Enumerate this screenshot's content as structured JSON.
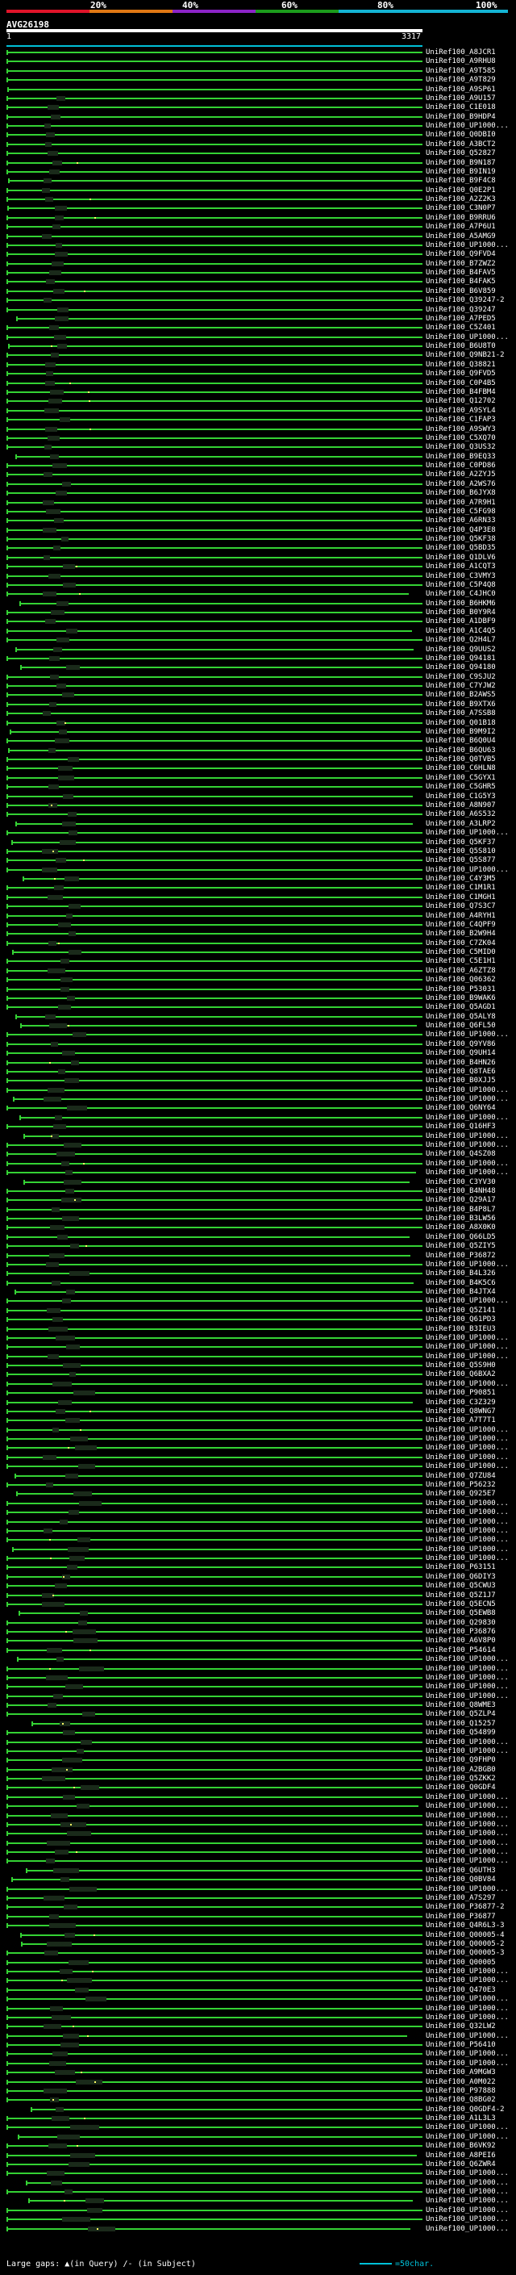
{
  "scale": {
    "labels": [
      "20%",
      "40%",
      "60%",
      "80%",
      "100%"
    ],
    "colors": [
      "#e0142a",
      "#e07814",
      "#8c24c8",
      "#1c9c1c",
      "#14b4d4"
    ]
  },
  "query": {
    "name": "AVG26198",
    "start": "1",
    "end": "3317",
    "line_color": "#00c0d8"
  },
  "hits": [
    "UniRef100_A8JCR1",
    "UniRef100_A9RHU8",
    "UniRef100_A9T585",
    "UniRef100_A9T829",
    "UniRef100_A9SP61",
    "UniRef100_A9U157",
    "UniRef100_C1E018",
    "UniRef100_B9HDP4",
    "UniRef100_UP1000...",
    "UniRef100_Q0DBI0",
    "UniRef100_A3BCT2",
    "UniRef100_Q52827",
    "UniRef100_B9N187",
    "UniRef100_B9IN19",
    "UniRef100_B9F4C8",
    "UniRef100_Q0E2P1",
    "UniRef100_A2Z2K3",
    "UniRef100_C3N0P7",
    "UniRef100_B9RRU6",
    "UniRef100_A7P6U1",
    "UniRef100_A5AMG9",
    "UniRef100_UP1000...",
    "UniRef100_Q9FVD4",
    "UniRef100_B7ZWZ2",
    "UniRef100_B4FAV5",
    "UniRef100_B4FAK5",
    "UniRef100_B6V859",
    "UniRef100_Q39247-2",
    "UniRef100_Q39247",
    "UniRef100_A7PED5",
    "UniRef100_C5Z401",
    "UniRef100_UP1000...",
    "UniRef100_B6U8T0",
    "UniRef100_Q9NB21-2",
    "UniRef100_Q38821",
    "UniRef100_Q9FVD5",
    "UniRef100_C0P4B5",
    "UniRef100_B4FBM4",
    "UniRef100_Q12702",
    "UniRef100_A9SYL4",
    "UniRef100_C1FAP3",
    "UniRef100_A9SWY3",
    "UniRef100_C5XQ70",
    "UniRef100_Q3US32",
    "UniRef100_B9EQ33",
    "UniRef100_C0PD86",
    "UniRef100_A2ZYJ5",
    "UniRef100_A2WS76",
    "UniRef100_B6JYX8",
    "UniRef100_A7R9H1",
    "UniRef100_C5FG98",
    "UniRef100_A6RN33",
    "UniRef100_Q4P3E8",
    "UniRef100_Q5KF38",
    "UniRef100_Q5BD35",
    "UniRef100_Q1DLV6",
    "UniRef100_A1CQT3",
    "UniRef100_C3VMY3",
    "UniRef100_C5P4Q8",
    "UniRef100_C4JHC0",
    "UniRef100_B6HKM6",
    "UniRef100_B0Y9R4",
    "UniRef100_A1DBF9",
    "UniRef100_A1C4Q5",
    "UniRef100_Q2H4L7",
    "UniRef100_Q9UUS2",
    "UniRef100_Q94181",
    "UniRef100_Q94180",
    "UniRef100_C9SJU2",
    "UniRef100_C7YJW2",
    "UniRef100_B2AWS5",
    "UniRef100_B9XTX6",
    "UniRef100_A7SSB8",
    "UniRef100_Q01B18",
    "UniRef100_B9M9I2",
    "UniRef100_B6Q0U4",
    "UniRef100_B6QU63",
    "UniRef100_Q0TVB5",
    "UniRef100_C6HLN8",
    "UniRef100_C5GYX1",
    "UniRef100_C5GHR5",
    "UniRef100_C1G5Y3",
    "UniRef100_A8N907",
    "UniRef100_A6S532",
    "UniRef100_A3LRP2",
    "UniRef100_UP1000...",
    "UniRef100_Q5KF37",
    "UniRef100_Q5S810",
    "UniRef100_Q5S877",
    "UniRef100_UP1000...",
    "UniRef100_C4Y3M5",
    "UniRef100_C1M1R1",
    "UniRef100_C1MGH1",
    "UniRef100_Q7S3C7",
    "UniRef100_A4RYH1",
    "UniRef100_C4QPF9",
    "UniRef100_B2W9H4",
    "UniRef100_C7ZK04",
    "UniRef100_C5MID0",
    "UniRef100_C5E1H1",
    "UniRef100_A6ZTZ8",
    "UniRef100_Q06362",
    "UniRef100_P53031",
    "UniRef100_B9WAK6",
    "UniRef100_Q5AGD1",
    "UniRef100_Q5ALY8",
    "UniRef100_Q6FL50",
    "UniRef100_UP1000...",
    "UniRef100_Q9YV86",
    "UniRef100_Q9UH14",
    "UniRef100_B4HN26",
    "UniRef100_Q8TAE6",
    "UniRef100_B0XJJ5",
    "UniRef100_UP1000...",
    "UniRef100_UP1000...",
    "UniRef100_Q6NY64",
    "UniRef100_UP1000...",
    "UniRef100_Q16HF3",
    "UniRef100_UP1000...",
    "UniRef100_UP1000...",
    "UniRef100_Q4SZ08",
    "UniRef100_UP1000...",
    "UniRef100_UP1000...",
    "UniRef100_C3YV30",
    "UniRef100_B4NH48",
    "UniRef100_Q29A17",
    "UniRef100_B4P8L7",
    "UniRef100_B3LW56",
    "UniRef100_A8X0K0",
    "UniRef100_Q66LD5",
    "UniRef100_Q5ZIY5",
    "UniRef100_P36872",
    "UniRef100_UP1000...",
    "UniRef100_B4L326",
    "UniRef100_B4K5C6",
    "UniRef100_B4JTX4",
    "UniRef100_UP1000...",
    "UniRef100_Q5Z141",
    "UniRef100_Q61PD3",
    "UniRef100_B3IEU3",
    "UniRef100_UP1000...",
    "UniRef100_UP1000...",
    "UniRef100_UP1000...",
    "UniRef100_Q5S9H0",
    "UniRef100_Q6BXA2",
    "UniRef100_UP1000...",
    "UniRef100_P90851",
    "UniRef100_C3Z329",
    "UniRef100_Q8WNG7",
    "UniRef100_A7T7T1",
    "UniRef100_UP1000...",
    "UniRef100_UP1000...",
    "UniRef100_UP1000...",
    "UniRef100_UP1000...",
    "UniRef100_UP1000...",
    "UniRef100_Q7ZU84",
    "UniRef100_P56232",
    "UniRef100_Q925E7",
    "UniRef100_UP1000...",
    "UniRef100_UP1000...",
    "UniRef100_UP1000...",
    "UniRef100_UP1000...",
    "UniRef100_UP1000...",
    "UniRef100_UP1000...",
    "UniRef100_UP1000...",
    "UniRef100_P63151",
    "UniRef100_Q6DIY3",
    "UniRef100_Q5CWU3",
    "UniRef100_Q5Z1J7",
    "UniRef100_Q5ECN5",
    "UniRef100_Q5EWB8",
    "UniRef100_Q29830",
    "UniRef100_P36876",
    "UniRef100_A6V8P0",
    "UniRef100_P54614",
    "UniRef100_UP1000...",
    "UniRef100_UP1000...",
    "UniRef100_UP1000...",
    "UniRef100_UP1000...",
    "UniRef100_UP1000...",
    "UniRef100_Q8WME3",
    "UniRef100_Q5ZLP4",
    "UniRef100_Q15257",
    "UniRef100_Q54899",
    "UniRef100_UP1000...",
    "UniRef100_UP1000...",
    "UniRef100_Q9FHP0",
    "UniRef100_A2BGB0",
    "UniRef100_Q5ZKK2",
    "UniRef100_Q0GDF4",
    "UniRef100_UP1000...",
    "UniRef100_UP1000...",
    "UniRef100_UP1000...",
    "UniRef100_UP1000...",
    "UniRef100_UP1000...",
    "UniRef100_UP1000...",
    "UniRef100_UP1000...",
    "UniRef100_UP1000...",
    "UniRef100_Q6UTH3",
    "UniRef100_Q0BV84",
    "UniRef100_UP1000...",
    "UniRef100_A7S297",
    "UniRef100_P36877-2",
    "UniRef100_P36877",
    "UniRef100_Q4R6L3-3",
    "UniRef100_Q00005-4",
    "UniRef100_Q00005-2",
    "UniRef100_Q00005-3",
    "UniRef100_Q00005",
    "UniRef100_UP1000...",
    "UniRef100_UP1000...",
    "UniRef100_Q470E3",
    "UniRef100_UP1000...",
    "UniRef100_UP1000...",
    "UniRef100_UP1000...",
    "UniRef100_Q32LW2",
    "UniRef100_UP1000...",
    "UniRef100_P56410",
    "UniRef100_UP1000...",
    "UniRef100_UP1000...",
    "UniRef100_A9MGW3",
    "UniRef100_A0M022",
    "UniRef100_P97888",
    "UniRef100_Q8BG02",
    "UniRef100_Q0GDF4-2",
    "UniRef100_A1L3L3",
    "UniRef100_UP1000...",
    "UniRef100_UP1000...",
    "UniRef100_B6VK92",
    "UniRef100_A8PEI6",
    "UniRef100_Q6ZWR4",
    "UniRef100_UP1000...",
    "UniRef100_UP1000...",
    "UniRef100_UP1000...",
    "UniRef100_UP1000...",
    "UniRef100_UP1000...",
    "UniRef100_UP1000...",
    "UniRef100_UP1000..."
  ],
  "footer": {
    "large_gaps_label": "Large gaps:",
    "query_symbol": "▲(in Query)",
    "subject_symbol": "/- (in Subject)",
    "legend_label": "=50char."
  }
}
